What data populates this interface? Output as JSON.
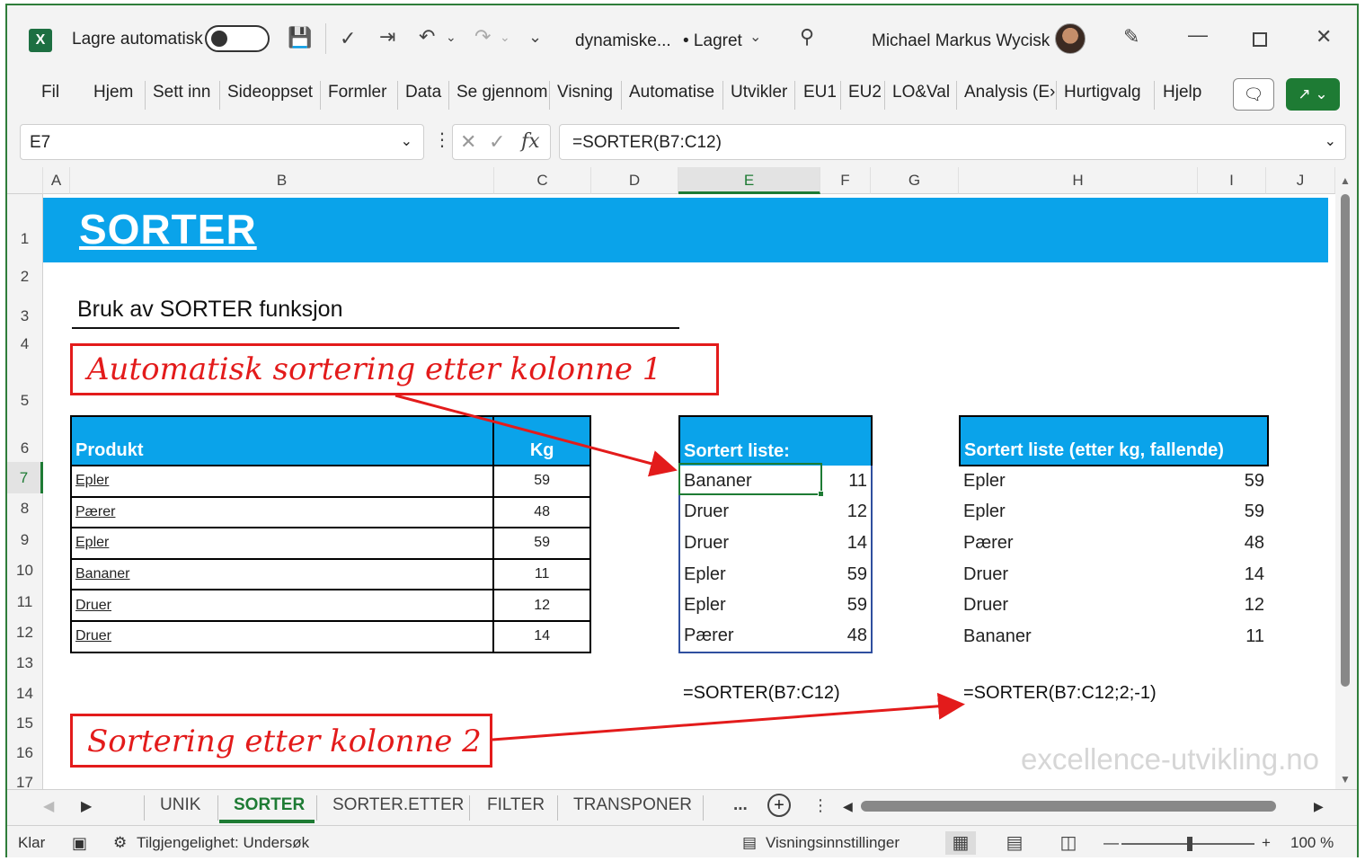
{
  "titlebar": {
    "autosave_label": "Lagre automatisk",
    "filename": "dynamiske...",
    "saved_status": "• Lagret",
    "user_name": "Michael Markus Wycisk"
  },
  "ribbon": {
    "tabs": [
      "Fil",
      "Hjem",
      "Sett inn",
      "Sideoppset",
      "Formler",
      "Data",
      "Se gjennom",
      "Visning",
      "Automatise",
      "Utvikler",
      "EU1",
      "EU2",
      "LO&Val",
      "Analysis (E›",
      "Hurtigvalg",
      "Hjelp"
    ]
  },
  "formula_bar": {
    "name_box": "E7",
    "fx": "fx",
    "formula": "=SORTER(B7:C12)"
  },
  "columns": [
    "A",
    "B",
    "C",
    "D",
    "E",
    "F",
    "G",
    "H",
    "I",
    "J"
  ],
  "rows": [
    "1",
    "2",
    "3",
    "4",
    "5",
    "6",
    "7",
    "8",
    "9",
    "10",
    "11",
    "12",
    "13",
    "14",
    "15",
    "16",
    "17"
  ],
  "sheet": {
    "banner_title": "SORTER",
    "subtitle": "Bruk av SORTER funksjon",
    "callout_1": "Automatisk sortering etter kolonne 1",
    "callout_2": "Sortering etter kolonne 2",
    "source_table": {
      "headers": [
        "Produkt",
        "Kg"
      ],
      "rows": [
        [
          "Epler",
          "59"
        ],
        [
          "Pærer",
          "48"
        ],
        [
          "Epler",
          "59"
        ],
        [
          "Bananer",
          "11"
        ],
        [
          "Druer",
          "12"
        ],
        [
          "Druer",
          "14"
        ]
      ]
    },
    "sorted_table": {
      "header": "Sortert liste:",
      "rows": [
        [
          "Bananer",
          "11"
        ],
        [
          "Druer",
          "12"
        ],
        [
          "Druer",
          "14"
        ],
        [
          "Epler",
          "59"
        ],
        [
          "Epler",
          "59"
        ],
        [
          "Pærer",
          "48"
        ]
      ]
    },
    "sorted_desc_table": {
      "header": "Sortert liste (etter kg, fallende)",
      "rows": [
        [
          "Epler",
          "59"
        ],
        [
          "Epler",
          "59"
        ],
        [
          "Pærer",
          "48"
        ],
        [
          "Druer",
          "14"
        ],
        [
          "Druer",
          "12"
        ],
        [
          "Bananer",
          "11"
        ]
      ]
    },
    "formula_text_1": "=SORTER(B7:C12)",
    "formula_text_2": "=SORTER(B7:C12;2;-1)",
    "watermark": "excellence-utvikling.no"
  },
  "sheet_tabs": {
    "tabs": [
      "UNIK",
      "SORTER",
      "SORTER.ETTER",
      "FILTER",
      "TRANSPONER"
    ],
    "active": "SORTER",
    "more": "..."
  },
  "statusbar": {
    "ready": "Klar",
    "accessibility": "Tilgjengelighet: Undersøk",
    "view_settings": "Visningsinnstillinger",
    "zoom": "100 %"
  },
  "colors": {
    "accent": "#1e7b34",
    "header_blue": "#0aa3ea",
    "callout_red": "#e31b1b"
  }
}
